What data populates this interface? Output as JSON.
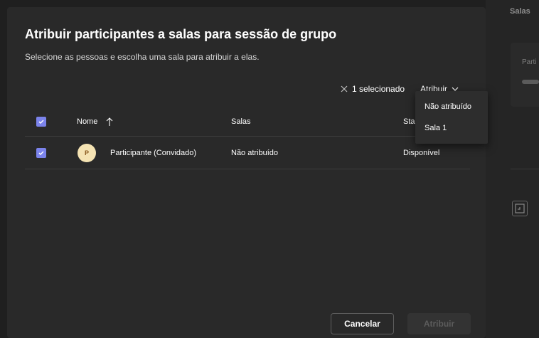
{
  "side_panel": {
    "title": "Salas",
    "card_label": "Parti"
  },
  "dialog": {
    "title": "Atribuir participantes a salas para sessão de grupo",
    "subtitle": "Selecione as pessoas e escolha uma sala para atribuir a elas."
  },
  "toolbar": {
    "selected_label": "1 selecionado",
    "assign_label": "Atribuir"
  },
  "table": {
    "headers": {
      "name": "Nome",
      "rooms": "Salas",
      "status": "Sta"
    },
    "rows": [
      {
        "avatar_initial": "P",
        "name": "Participante (Convidado)",
        "room": "Não atribuído",
        "status": "Disponível"
      }
    ]
  },
  "dropdown": {
    "options": [
      "Não atribuído",
      "Sala 1"
    ]
  },
  "footer": {
    "cancel_label": "Cancelar",
    "assign_label": "Atribuir"
  },
  "colors": {
    "accent": "#7b83eb",
    "avatar_bg": "#f5e3b3",
    "dialog_bg": "#292929"
  }
}
